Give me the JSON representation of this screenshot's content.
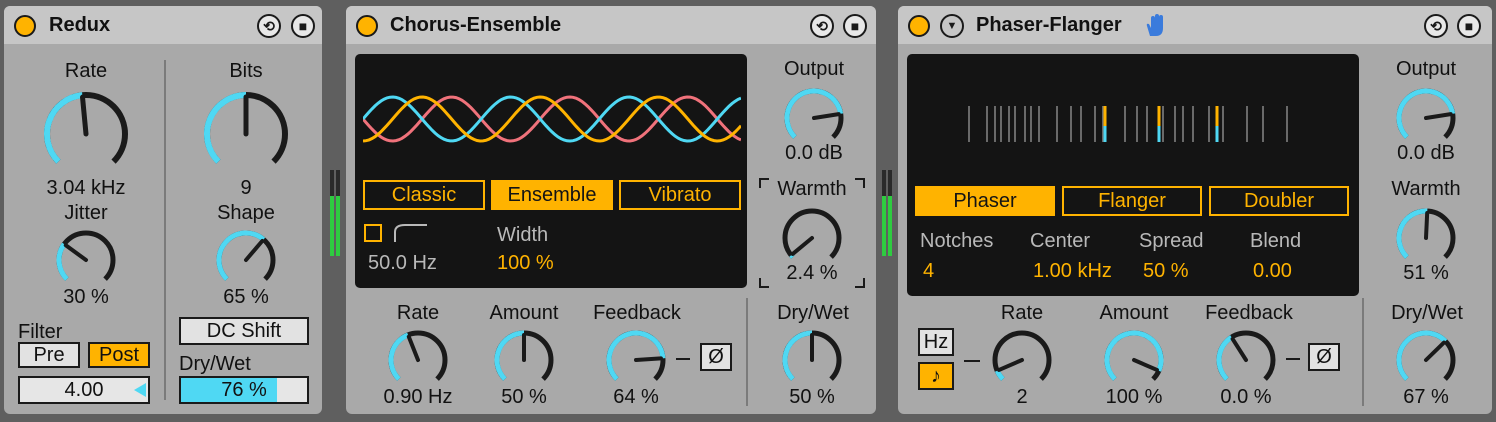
{
  "colors": {
    "accent": "#ffb300",
    "knob_arc": "#4fd8f3",
    "panel": "#a9a9a9",
    "screen": "#141414",
    "wave_pink": "#f0727b",
    "wave_blue": "#4fd8f3",
    "wave_orange": "#ffb300"
  },
  "redux": {
    "title": "Redux",
    "rate": {
      "label": "Rate",
      "value": "3.04 kHz",
      "level": 0.48
    },
    "jitter": {
      "label": "Jitter",
      "value": "30 %",
      "level": 0.3
    },
    "bits": {
      "label": "Bits",
      "value": "9",
      "level": 0.5
    },
    "shape": {
      "label": "Shape",
      "value": "65 %",
      "level": 0.65
    },
    "filter_label": "Filter",
    "pre_label": "Pre",
    "post_label": "Post",
    "filter_value": "4.00",
    "dc_shift_label": "DC Shift",
    "drywet_label": "Dry/Wet",
    "drywet_value": "76 %",
    "drywet_level": 0.76
  },
  "chorus": {
    "title": "Chorus-Ensemble",
    "modes": [
      "Classic",
      "Ensemble",
      "Vibrato"
    ],
    "active_mode": "Ensemble",
    "hp_value": "50.0 Hz",
    "width_label": "Width",
    "width_value": "100 %",
    "output": {
      "label": "Output",
      "value": "0.0 dB",
      "level": 0.8
    },
    "warmth": {
      "label": "Warmth",
      "value": "2.4 %",
      "level": 0.02
    },
    "rate": {
      "label": "Rate",
      "value": "0.90 Hz",
      "level": 0.42
    },
    "amount": {
      "label": "Amount",
      "value": "50 %",
      "level": 0.5
    },
    "feedback": {
      "label": "Feedback",
      "value": "64 %",
      "level": 0.82
    },
    "invert_label": "Ø",
    "drywet": {
      "label": "Dry/Wet",
      "value": "50 %",
      "level": 0.5
    }
  },
  "phaser": {
    "title": "Phaser-Flanger",
    "modes": [
      "Phaser",
      "Flanger",
      "Doubler"
    ],
    "active_mode": "Phaser",
    "notches": {
      "label": "Notches",
      "value": "4"
    },
    "center": {
      "label": "Center",
      "value": "1.00 kHz"
    },
    "spread": {
      "label": "Spread",
      "value": "50 %"
    },
    "blend": {
      "label": "Blend",
      "value": "0.00"
    },
    "output": {
      "label": "Output",
      "value": "0.0 dB",
      "level": 0.8
    },
    "warmth": {
      "label": "Warmth",
      "value": "51 %",
      "level": 0.51
    },
    "hz_label": "Hz",
    "note_label": "♪",
    "rate": {
      "label": "Rate",
      "value": "2",
      "level": 0.08
    },
    "amount": {
      "label": "Amount",
      "value": "100 %",
      "level": 0.92
    },
    "feedback": {
      "label": "Feedback",
      "value": "0.0 %",
      "level": 0.38
    },
    "invert_label": "Ø",
    "drywet": {
      "label": "Dry/Wet",
      "value": "67 %",
      "level": 0.67
    }
  }
}
